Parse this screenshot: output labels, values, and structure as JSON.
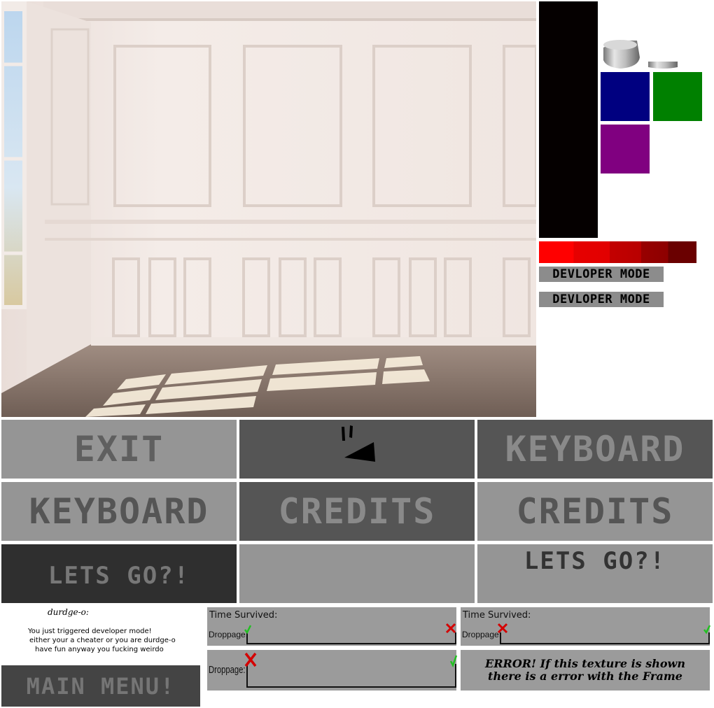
{
  "devmode": {
    "label1": "DEVLOPER MODE",
    "label2": "DEVLOPER MODE"
  },
  "swatches": {
    "colors": [
      "#000080",
      "#008000",
      "#800080"
    ]
  },
  "buttons": {
    "exit": "EXIT",
    "keyboard_top": "KEYBOARD",
    "keyboard_left": "KEYBOARD",
    "credits_dark": "CREDITS",
    "credits_light": "CREDITS",
    "letsgo_dark": "LETS GO?!",
    "letsgo_light": "LETS GO?!"
  },
  "dev_message": {
    "signature": "durdge-o:",
    "line1": "You just triggered developer mode!",
    "line2": "either your a cheater or you are durdge-o",
    "line3": "have fun anyway you fucking weirdo"
  },
  "main_menu": "MAIN MENU!",
  "hud": {
    "time_label": "Time Survived:",
    "droppage_label": "Droppage:"
  },
  "error_frame": {
    "line1": "ERROR! If this texture is shown",
    "line2": "there is a error with the Frame"
  }
}
